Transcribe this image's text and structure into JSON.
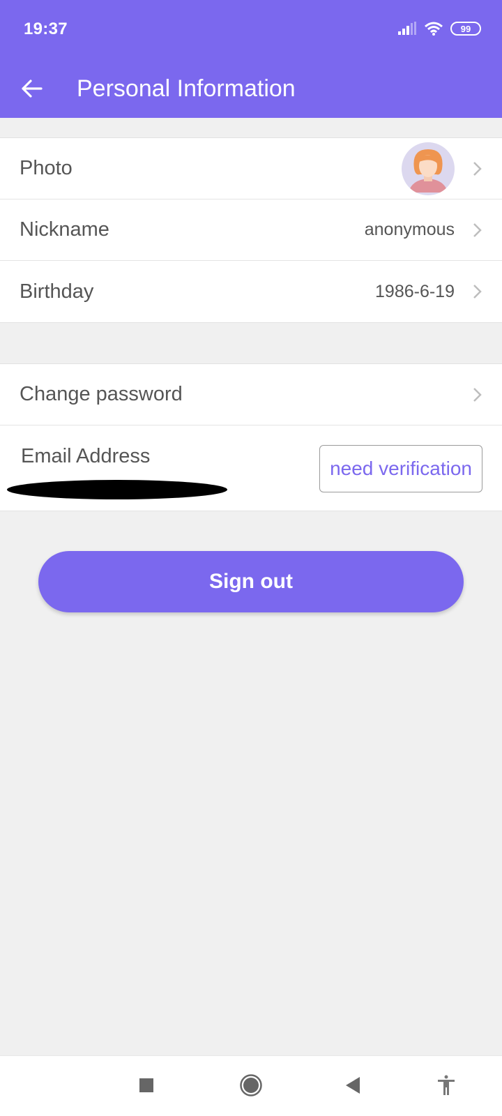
{
  "status_bar": {
    "time": "19:37",
    "battery": "99",
    "icons": [
      "signal-icon",
      "wifi-icon",
      "battery-icon"
    ]
  },
  "header": {
    "back_icon": "arrow-left-icon",
    "title": "Personal Information"
  },
  "profile": {
    "photo_label": "Photo",
    "nickname_label": "Nickname",
    "nickname_value": "anonymous",
    "birthday_label": "Birthday",
    "birthday_value": "1986-6-19"
  },
  "account": {
    "change_password_label": "Change password",
    "email_label": "Email Address",
    "verify_button": "need verification"
  },
  "signout_label": "Sign out",
  "nav": {
    "icons": [
      "recents-icon",
      "home-icon",
      "back-icon",
      "accessibility-icon"
    ]
  },
  "colors": {
    "accent": "#7b68ee",
    "background": "#f0f0f0",
    "text": "#555555"
  }
}
